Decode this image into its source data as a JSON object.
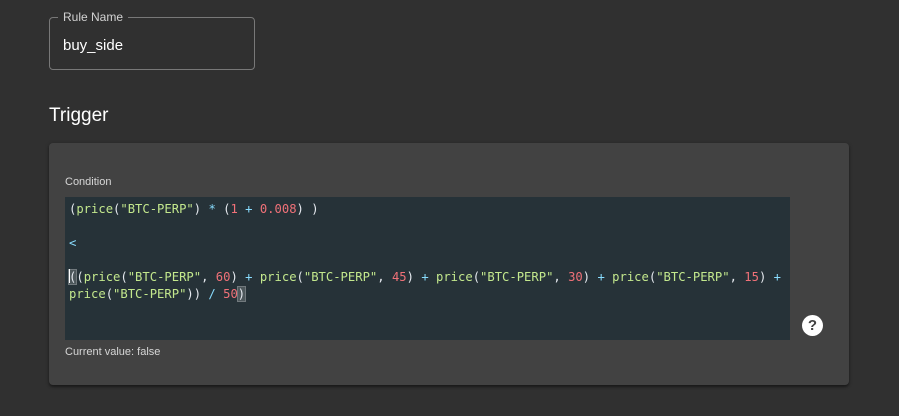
{
  "rule_name": {
    "label": "Rule Name",
    "value": "buy_side"
  },
  "trigger": {
    "title": "Trigger",
    "condition_label": "Condition",
    "current_value": "Current value: false",
    "help_icon": "help-circle-icon",
    "code_lines": [
      "(price(\"BTC-PERP\") * (1 + 0.008) )",
      "",
      "<",
      "",
      "((price(\"BTC-PERP\", 60) + price(\"BTC-PERP\", 45) + price(\"BTC-PERP\", 30) + price(\"BTC-PERP\", 15) +",
      "price(\"BTC-PERP\")) / 50)"
    ]
  },
  "colors": {
    "background": "#303030",
    "card": "#424242",
    "editor_bg": "#263238",
    "function_and_string": "#c3e88d",
    "number": "#f07178",
    "operator": "#89ddff"
  }
}
